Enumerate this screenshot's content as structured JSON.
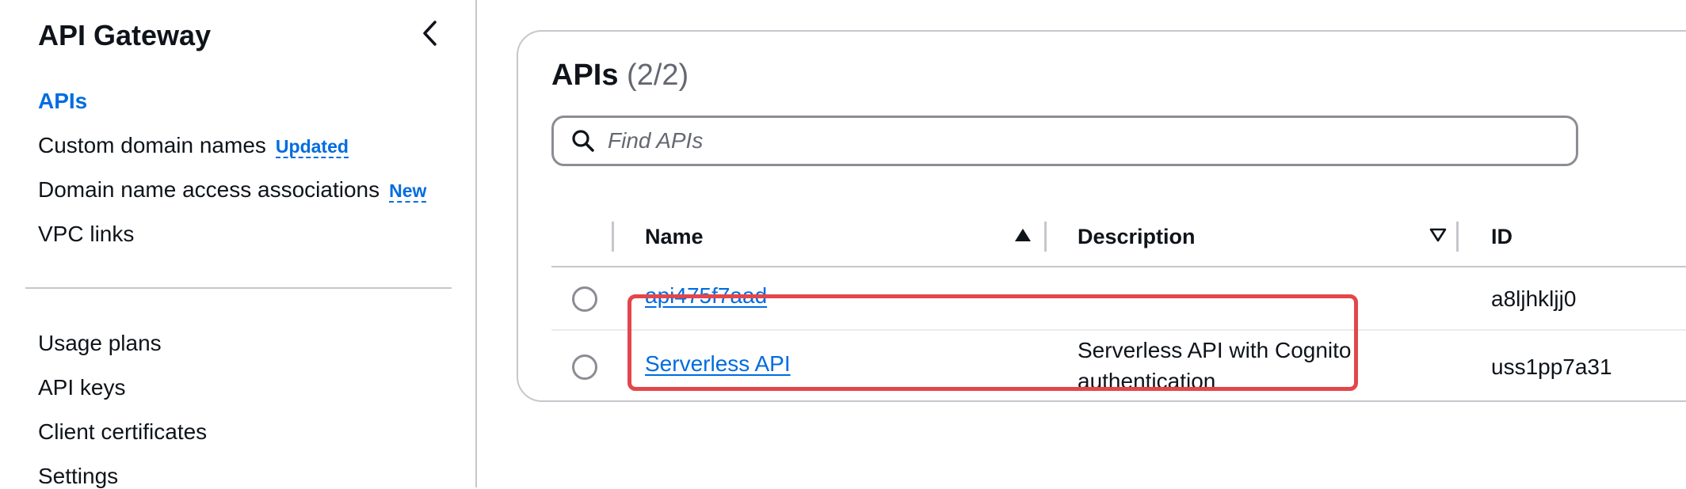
{
  "sidebar": {
    "title": "API Gateway",
    "collapse_icon": "chevron-left-icon",
    "items": [
      {
        "label": "APIs",
        "active": true
      },
      {
        "label": "Custom domain names",
        "badge": "Updated"
      },
      {
        "label": "Domain name access associations",
        "badge": "New"
      },
      {
        "label": "VPC links"
      },
      {
        "label": "Usage plans"
      },
      {
        "label": "API keys"
      },
      {
        "label": "Client certificates"
      },
      {
        "label": "Settings"
      }
    ]
  },
  "main": {
    "title": "APIs",
    "count": "(2/2)",
    "search": {
      "placeholder": "Find APIs",
      "icon": "search-icon"
    },
    "columns": [
      "Name",
      "Description",
      "ID"
    ],
    "rows": [
      {
        "name": "api475f7aad",
        "description": "",
        "id": "a8ljhkljj0"
      },
      {
        "name": "Serverless API",
        "description": "Serverless API with Cognito authentication",
        "id": "uss1pp7a31"
      }
    ]
  },
  "colors": {
    "accent": "#006ce0",
    "highlight": "#e3474a",
    "border": "#c6c6cd"
  }
}
